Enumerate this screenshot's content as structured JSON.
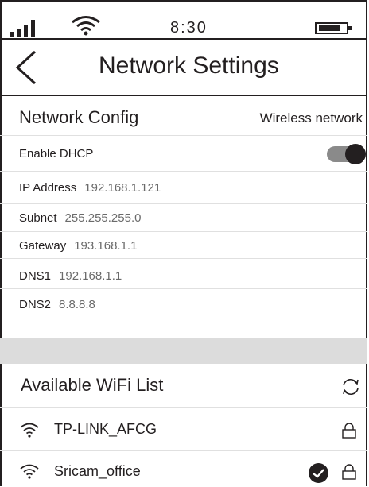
{
  "status_bar": {
    "time": "8:30",
    "signal_icon": "signal-bars-icon",
    "wifi_icon": "wifi-icon",
    "battery_icon": "battery-icon"
  },
  "header": {
    "back_icon": "chevron-left-icon",
    "title": "Network Settings"
  },
  "network_config": {
    "title": "Network Config",
    "mode": "Wireless network",
    "dhcp_label": "Enable DHCP",
    "dhcp_enabled": true,
    "fields": [
      {
        "label": "IP Address",
        "value": "192.168.1.121"
      },
      {
        "label": "Subnet",
        "value": "255.255.255.0"
      },
      {
        "label": "Gateway",
        "value": "193.168.1.1"
      },
      {
        "label": "DNS1",
        "value": "192.168.1.1"
      },
      {
        "label": "DNS2",
        "value": "8.8.8.8"
      }
    ]
  },
  "wifi_list": {
    "title": "Available WiFi List",
    "refresh_icon": "refresh-icon",
    "networks": [
      {
        "name": "TP-LINK_AFCG",
        "locked": true,
        "connected": false
      },
      {
        "name": "Sricam_office",
        "locked": true,
        "connected": true
      }
    ]
  }
}
